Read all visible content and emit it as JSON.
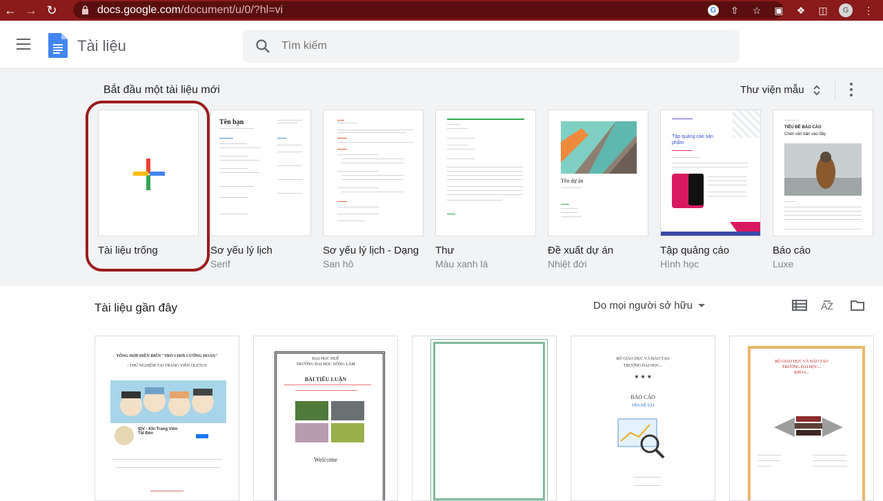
{
  "browser": {
    "url_host": "docs.google.com",
    "url_path": "/document/u/0/?hl=vi",
    "avatar_letter": "G"
  },
  "header": {
    "app_title": "Tài liệu",
    "search_placeholder": "Tìm kiếm"
  },
  "gallery": {
    "title": "Bắt đầu một tài liệu mới",
    "library_label": "Thư viện mẫu",
    "templates": [
      {
        "name": "Tài liệu trống",
        "sub": ""
      },
      {
        "name": "Sơ yếu lý lịch",
        "sub": "Serif"
      },
      {
        "name": "Sơ yếu lý lịch - Dạng",
        "sub": "San hô"
      },
      {
        "name": "Thư",
        "sub": "Màu xanh lá"
      },
      {
        "name": "Đề xuất dự án",
        "sub": "Nhiệt đới"
      },
      {
        "name": "Tập quảng cáo",
        "sub": "Hình học"
      },
      {
        "name": "Báo cáo",
        "sub": "Luxe"
      }
    ],
    "thumbs": {
      "resume_name": "Tên bạn",
      "proposal_title": "Tên dự án",
      "brochure_title": "Tập quảng cáo sản phẩm",
      "report_title": "TIÊU ĐỀ BÁO CÁO",
      "report_sub": "Chèn văn bản vào đây"
    }
  },
  "recent": {
    "title": "Tài liệu gần đây",
    "owner_filter": "Do mọi người sở hữu",
    "docs": [
      {
        "line1": "TỔNG HỢP DIỄN BIẾN \"TRÒ CHƠI CƯỠNG HOÀN\"",
        "line2": "- THỬ NGHIỆM TẠI TRANG VIÊN OLETUS",
        "caption": "IDV - Khi Trang Viên Tắt Đèn"
      },
      {
        "line1": "ĐẠI HỌC HUẾ",
        "line2": "TRƯỜNG ĐẠI HỌC NÔNG LÂM",
        "title": "BÀI TIỂU LUẬN",
        "welcome": "Welcome"
      },
      {},
      {
        "line1": "BỘ GIÁO DỤC VÀ ĐÀO TẠO",
        "line2": "TRƯỜNG ĐẠI HỌC...",
        "title": "BÁO CÁO",
        "sub": "TÊN ĐỀ TÀI"
      },
      {
        "line1": "BỘ GIÁO DỤC VÀ ĐÀO TẠO",
        "line2": "TRƯỜNG ĐẠI HỌC...",
        "line3": "KHOA..."
      }
    ]
  },
  "colors": {
    "chrome_bg": "#8b1a1a",
    "docs_blue": "#4285f4",
    "highlight": "#9b1c1c",
    "gallery_bg": "#f1f3f4"
  }
}
